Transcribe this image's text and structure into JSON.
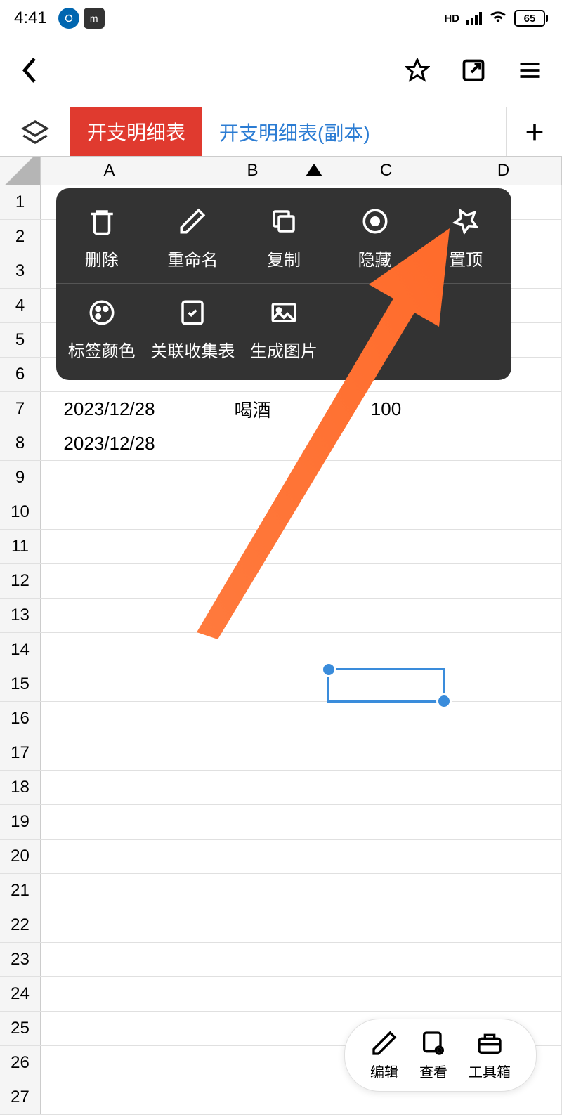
{
  "status": {
    "time": "4:41",
    "hd_label": "HD",
    "battery": "65"
  },
  "tabs": {
    "active": "开支明细表",
    "inactive": "开支明细表(副本)"
  },
  "columns": [
    "A",
    "B",
    "C",
    "D"
  ],
  "rows": [
    "1",
    "2",
    "3",
    "4",
    "5",
    "6",
    "7",
    "8",
    "9",
    "10",
    "11",
    "12",
    "13",
    "14",
    "15",
    "16",
    "17",
    "18",
    "19",
    "20",
    "21",
    "22",
    "23",
    "24",
    "25",
    "26",
    "27"
  ],
  "cells": {
    "r7": {
      "a": "2023/12/28",
      "b": "喝酒",
      "c": "100"
    },
    "r8": {
      "a": "2023/12/28"
    }
  },
  "menu": {
    "delete": "删除",
    "rename": "重命名",
    "copy": "复制",
    "hide": "隐藏",
    "pin": "置顶",
    "tag_color": "标签颜色",
    "link_form": "关联收集表",
    "gen_image": "生成图片"
  },
  "bottom": {
    "edit": "编辑",
    "view": "查看",
    "toolbox": "工具箱"
  }
}
